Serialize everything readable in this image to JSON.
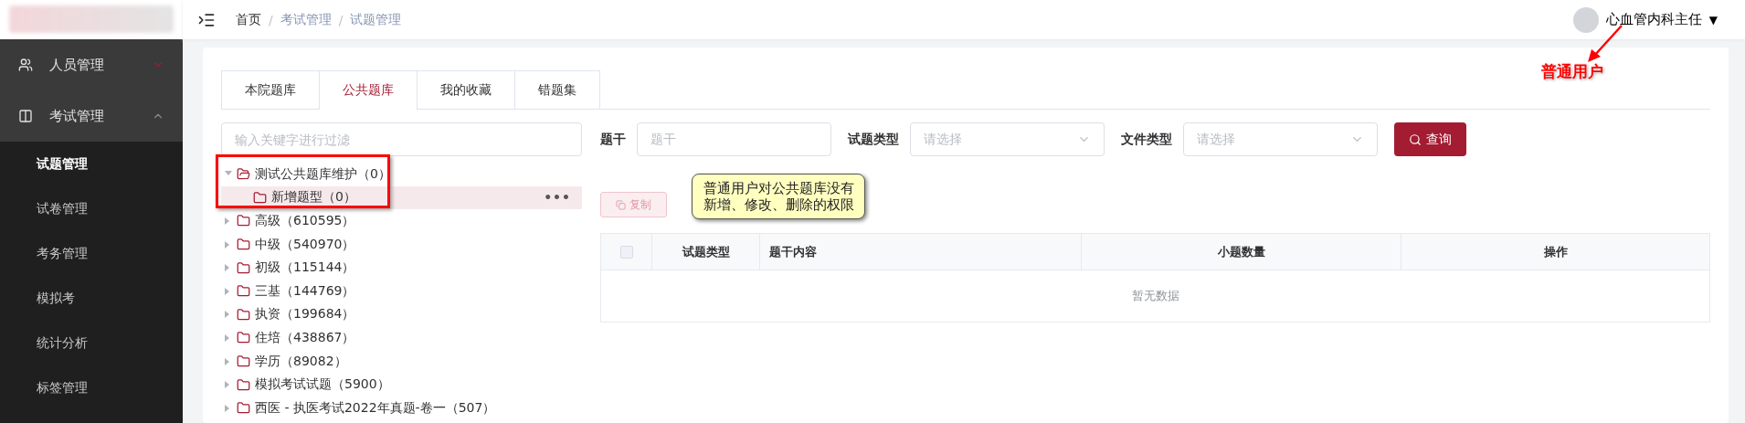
{
  "header": {
    "breadcrumb": [
      {
        "label": "首页",
        "link": false
      },
      {
        "label": "考试管理",
        "link": true
      },
      {
        "label": "试题管理",
        "link": true
      }
    ],
    "separator": "/",
    "user": {
      "name": "心血管内科主任",
      "caret": "▼"
    }
  },
  "sidebar": {
    "items": [
      {
        "label": "人员管理",
        "expanded": false
      },
      {
        "label": "考试管理",
        "expanded": true,
        "children": [
          {
            "label": "试题管理",
            "selected": true
          },
          {
            "label": "试卷管理",
            "selected": false
          },
          {
            "label": "考务管理",
            "selected": false
          },
          {
            "label": "模拟考",
            "selected": false
          },
          {
            "label": "统计分析",
            "selected": false
          },
          {
            "label": "标签管理",
            "selected": false
          }
        ]
      }
    ]
  },
  "tabs": [
    {
      "label": "本院题库",
      "selected": false
    },
    {
      "label": "公共题库",
      "selected": true
    },
    {
      "label": "我的收藏",
      "selected": false
    },
    {
      "label": "错题集",
      "selected": false
    }
  ],
  "tree": {
    "placeholder": "输入关键字进行过滤",
    "more": "•••",
    "items": [
      {
        "label": "测试公共题库维护（0）",
        "expanded": true,
        "selected": false,
        "children": [
          {
            "label": "新增题型（0）",
            "expanded": false,
            "selected": true
          }
        ]
      },
      {
        "label": "高级（610595）",
        "expanded": false,
        "selected": false
      },
      {
        "label": "中级（540970）",
        "expanded": false,
        "selected": false
      },
      {
        "label": "初级（115144）",
        "expanded": false,
        "selected": false
      },
      {
        "label": "三基（144769）",
        "expanded": false,
        "selected": false
      },
      {
        "label": "执资（199684）",
        "expanded": false,
        "selected": false
      },
      {
        "label": "住培（438867）",
        "expanded": false,
        "selected": false
      },
      {
        "label": "学历（89082）",
        "expanded": false,
        "selected": false
      },
      {
        "label": "模拟考试试题（5900）",
        "expanded": false,
        "selected": false
      },
      {
        "label": "西医 - 执医考试2022年真题-卷一（507）",
        "expanded": false,
        "selected": false
      }
    ]
  },
  "filters": [
    {
      "label": "题干",
      "kind": "text",
      "placeholder": "题干"
    },
    {
      "label": "试题类型",
      "kind": "select",
      "placeholder": "请选择"
    },
    {
      "label": "文件类型",
      "kind": "select",
      "placeholder": "请选择"
    }
  ],
  "search_button": "查询",
  "copy_button": {
    "label": "复制",
    "disabled": true
  },
  "table": {
    "checked": false,
    "columns": [
      "试题类型",
      "题干内容",
      "小题数量",
      "操作"
    ],
    "empty_text": "暂无数据"
  },
  "annotations": {
    "callout": "普通用户对公共题库没有新增、修改、删除的权限",
    "user_label": "普通用户"
  }
}
